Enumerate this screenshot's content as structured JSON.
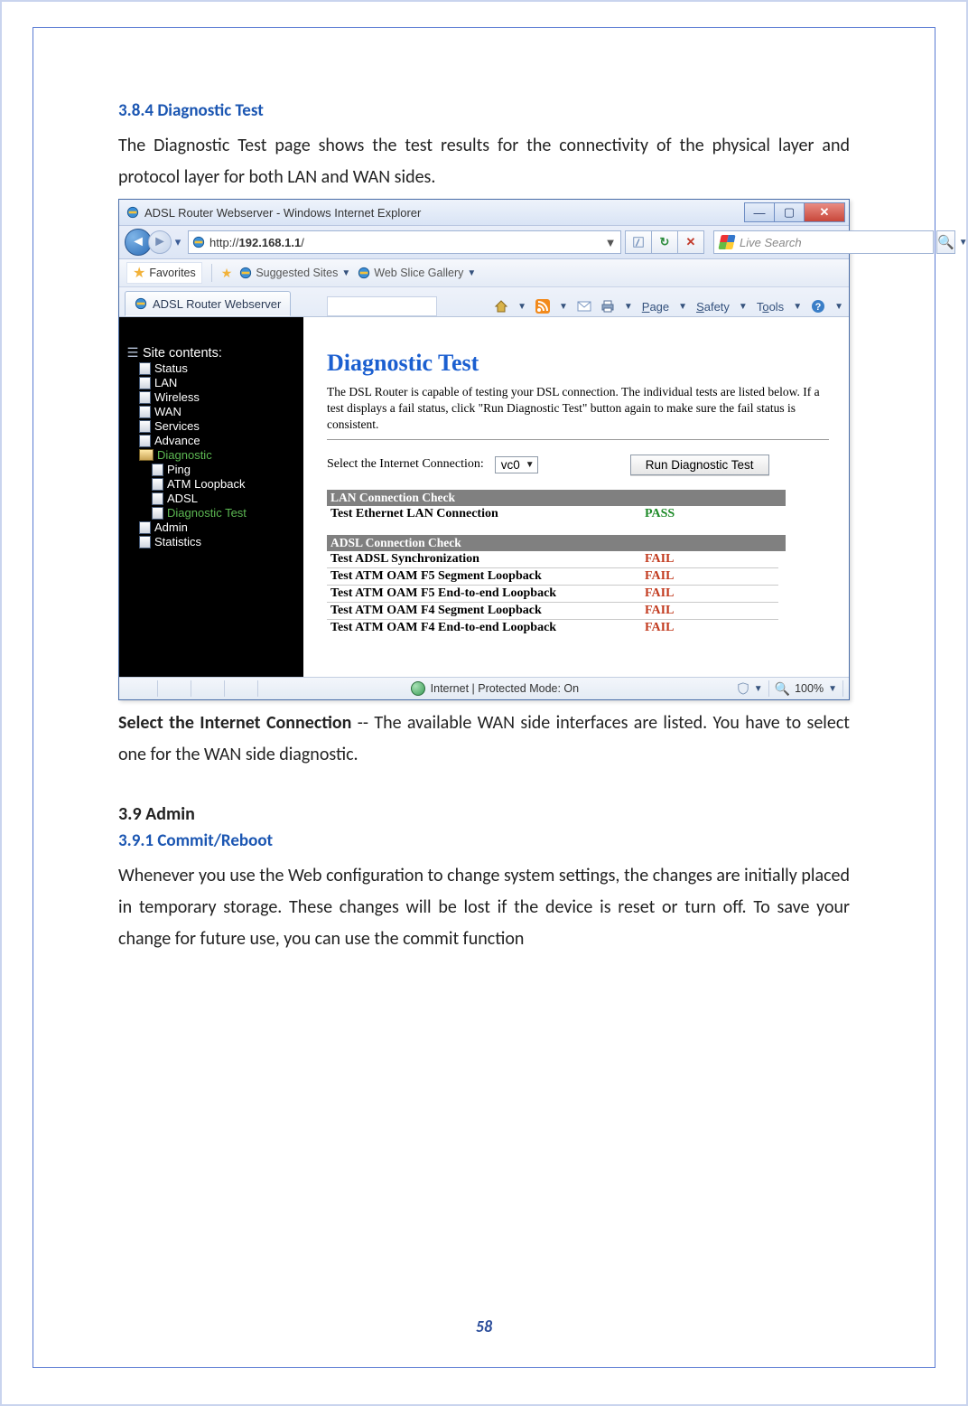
{
  "section_heading_1": "3.8.4 Diagnostic Test",
  "para_1": "The Diagnostic Test page shows the test results for the connectivity of the physical layer and protocol layer for both LAN and WAN sides.",
  "browser": {
    "title": "ADSL Router Webserver - Windows Internet Explorer",
    "url_prefix": "http://",
    "url_host": "192.168.1.1",
    "url_suffix": "/",
    "search_placeholder": "Live Search",
    "favorites_label": "Favorites",
    "suggested_sites": "Suggested Sites",
    "web_slice": "Web Slice Gallery",
    "tab_title": "ADSL Router Webserver",
    "menu_page": "Page",
    "menu_safety": "Safety",
    "menu_tools": "Tools",
    "status_text": "Internet | Protected Mode: On",
    "zoom": "100%"
  },
  "sidebar": {
    "root": "Site contents:",
    "items": {
      "status": "Status",
      "lan": "LAN",
      "wireless": "Wireless",
      "wan": "WAN",
      "services": "Services",
      "advance": "Advance",
      "diagnostic": "Diagnostic",
      "ping": "Ping",
      "atm_loopback": "ATM Loopback",
      "adsl": "ADSL",
      "diag_test": "Diagnostic Test",
      "admin": "Admin",
      "statistics": "Statistics"
    }
  },
  "router": {
    "title": "Diagnostic Test",
    "desc": "The DSL Router is capable of testing your DSL connection. The individual tests are listed below. If a test displays a fail status, click \"Run Diagnostic Test\" button again to make sure the fail status is consistent.",
    "select_label": "Select the Internet Connection:",
    "select_value": "vc0",
    "run_btn": "Run Diagnostic Test",
    "lan_header": "LAN Connection Check",
    "lan_rows": [
      {
        "name": "Test Ethernet LAN Connection",
        "result": "PASS",
        "ok": true
      }
    ],
    "adsl_header": "ADSL Connection Check",
    "adsl_rows": [
      {
        "name": "Test ADSL Synchronization",
        "result": "FAIL",
        "ok": false
      },
      {
        "name": "Test ATM OAM F5 Segment Loopback",
        "result": "FAIL",
        "ok": false
      },
      {
        "name": "Test ATM OAM F5 End-to-end Loopback",
        "result": "FAIL",
        "ok": false
      },
      {
        "name": "Test ATM OAM F4 Segment Loopback",
        "result": "FAIL",
        "ok": false
      },
      {
        "name": "Test ATM OAM F4 End-to-end Loopback",
        "result": "FAIL",
        "ok": false
      }
    ]
  },
  "para_2_lead": "Select the Internet Connection",
  "para_2_rest": " -- The available WAN side interfaces are listed. You have to select one for the WAN side diagnostic.",
  "section_heading_2": "3.9 Admin",
  "section_heading_3": "3.9.1 Commit/Reboot",
  "para_3": "Whenever you use the Web configuration to change system settings, the changes are initially placed in temporary storage. These changes will be lost if the device is reset or turn off. To save your change for future use, you can use the commit function",
  "page_number": "58"
}
